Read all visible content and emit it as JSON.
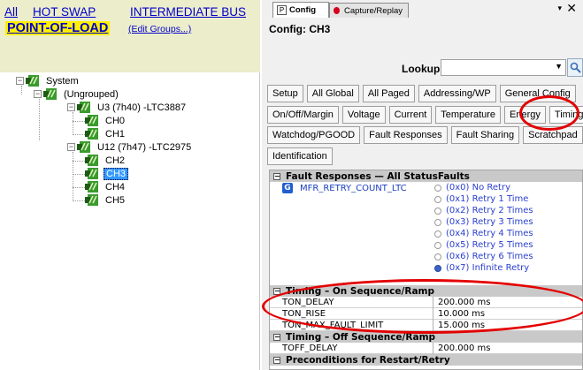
{
  "groups": {
    "all": "All",
    "hot_swap": "HOT SWAP",
    "intermediate_bus": "INTERMEDIATE BUS",
    "point_of_load": "POINT-OF-LOAD",
    "edit_groups": "(Edit Groups...)"
  },
  "tree": {
    "system": "System",
    "ungrouped": "(Ungrouped)",
    "u3": "U3 (7h40) -LTC3887",
    "ch0": "CH0",
    "ch1": "CH1",
    "u12": "U12 (7h47) -LTC2975",
    "ch2": "CH2",
    "ch3": "CH3",
    "ch4": "CH4",
    "ch5": "CH5"
  },
  "tabs": {
    "config": "Config",
    "capture": "Capture/Replay",
    "pin": "▾",
    "close": "✕"
  },
  "config_title": "Config: CH3",
  "lookup": {
    "label": "Lookup:",
    "value": ""
  },
  "config_tabs": {
    "row1": [
      "Setup",
      "All Global",
      "All Paged",
      "Addressing/WP",
      "General Config"
    ],
    "row2": [
      "On/Off/Margin",
      "Voltage",
      "Current",
      "Temperature",
      "Energy",
      "Timing"
    ],
    "row3": [
      "Watchdog/PGOOD",
      "Fault Responses",
      "Fault Sharing",
      "Scratchpad"
    ],
    "row4": [
      "Identification"
    ],
    "active": "Timing"
  },
  "grid": {
    "cat_fault": "Fault Responses — All StatusFaults",
    "retry_name": "MFR_RETRY_COUNT_LTC",
    "retry_options": [
      "(0x0) No Retry",
      "(0x1) Retry 1 Time",
      "(0x2) Retry 2 Times",
      "(0x3) Retry 3 Times",
      "(0x4) Retry 4 Times",
      "(0x5) Retry 5 Times",
      "(0x6) Retry 6 Times",
      "(0x7) Infinite Retry"
    ],
    "retry_selected": "(0x7) Infinite Retry",
    "cat_on_seq": "Timing – On Sequence/Ramp",
    "ton_delay_name": "TON_DELAY",
    "ton_delay_val": "200.000 ms",
    "ton_rise_name": "TON_RISE",
    "ton_rise_val": "10.000 ms",
    "ton_max_name": "TON_MAX_FAULT_LIMIT",
    "ton_max_val": "15.000 ms",
    "cat_off_seq": "Timing – Off Sequence/Ramp",
    "toff_delay_name": "TOFF_DELAY",
    "toff_delay_val": "200.000 ms",
    "cat_precond": "Preconditions for Restart/Retry"
  },
  "colors": {
    "group_bar": "#ecedca",
    "highlight": "#fff000",
    "link": "#0000cc",
    "selection": "#3399ff",
    "annotation": "#e30000"
  },
  "icons": {
    "device": "green-chip-icon",
    "lookup": "magnifier-icon",
    "retry": "g-register-icon"
  }
}
